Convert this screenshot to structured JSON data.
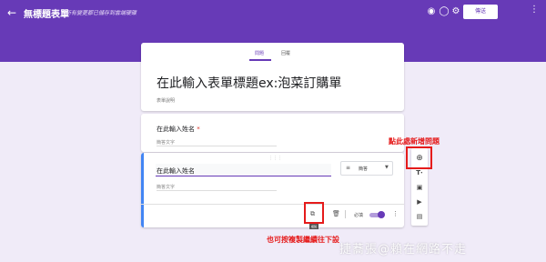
{
  "header": {
    "title": "無標題表單",
    "subtitle": "所有變更都已儲存到雲端硬碟",
    "send_label": "傳送",
    "icons": [
      "back-arrow-icon",
      "palette-icon",
      "eye-icon",
      "gear-icon",
      "more-vert-icon"
    ]
  },
  "tabs": [
    "問題",
    "回覆"
  ],
  "form": {
    "title": "在此輸入表單標題ex:泡菜訂購單",
    "description": "表單說明"
  },
  "question1": {
    "label": "在此輸入姓名",
    "required_mark": "*",
    "answer_placeholder": "簡答文字"
  },
  "question2": {
    "value": "在此輸入姓名",
    "answer_placeholder": "簡答文字",
    "type": "簡答",
    "copy_tip": "複製",
    "required_label": "必填"
  },
  "annotations": {
    "add_question": "點此處新增問題",
    "copy_hint": "也可按複製繼續往下設"
  },
  "watermark": "捷蕎張@賴在網路不走",
  "colors": {
    "primary": "#673ab7",
    "background": "#f0ebf8",
    "annotation": "#e51b1b",
    "active_question": "#4285f4"
  }
}
